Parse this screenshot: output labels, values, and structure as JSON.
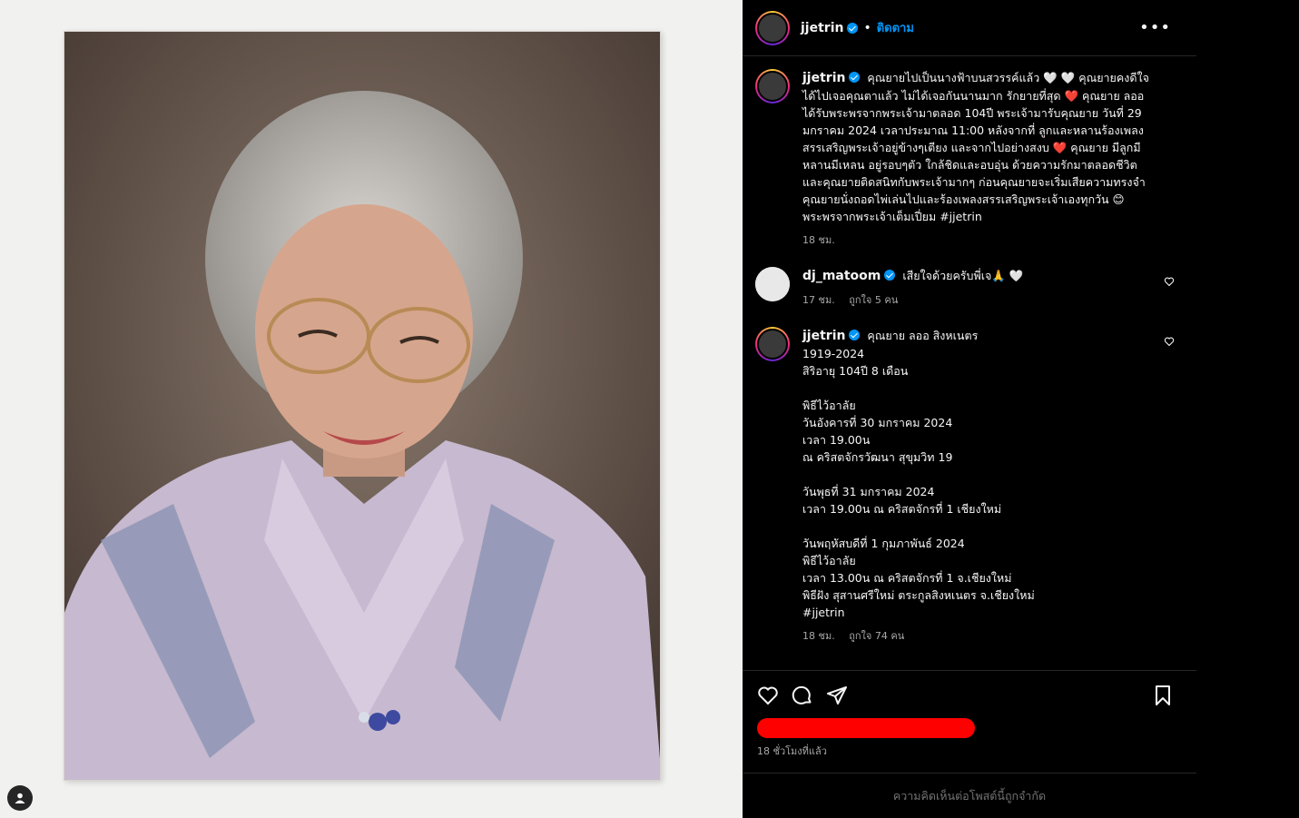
{
  "post": {
    "username": "jjetrin",
    "follow_label": "ติดตาม",
    "more_label": "•••"
  },
  "caption": {
    "username": "jjetrin",
    "text": "คุณยายไปเป็นนางฟ้าบนสวรรค์แล้ว 🤍 🤍 คุณยายคงดีใจ ได้ไปเจอคุณตาแล้ว ไม่ได้เจอกันนานมาก รักยายที่สุด ❤️ คุณยาย ลออ ได้รับพระพรจากพระเจ้ามาตลอด 104ปี พระเจ้ามารับคุณยาย วันที่ 29 มกราคม 2024 เวลาประมาณ 11:00 หลังจากที่ ลูกและหลานร้องเพลงสรรเสริญพระเจ้าอยู่ข้างๆเตียง และจากไปอย่างสงบ ❤️ คุณยาย มีลูกมีหลานมีเหลน อยู่รอบๆตัว ใกล้ชิดและอบอุ่น ด้วยความรักมาตลอดชีวิต และคุณยายติดสนิทกับพระเจ้ามากๆ ก่อนคุณยายจะเริ่มเสียความทรงจำ คุณยายนั่งถอดไพ่เล่นไปและร้องเพลงสรรเสริญพระเจ้าเองทุกวัน 😊 พระพรจากพระเจ้าเต็มเปี่ยม #jjetrin",
    "time": "18 ชม."
  },
  "comments": [
    {
      "username": "dj_matoom",
      "text": "เสียใจด้วยครับพี่เจ🙏 🤍",
      "time": "17 ชม.",
      "likes": "ถูกใจ 5 คน"
    },
    {
      "username": "jjetrin",
      "text": "คุณยาย ลออ สิงหเนตร\n1919-2024\nสิริอายุ 104ปี 8 เดือน\n\nพิธีไว้อาลัย\nวันอังคารที่ 30 มกราคม 2024\nเวลา 19.00น\nณ คริสตจักรวัฒนา สุขุมวิท 19\n\nวันพุธที่ 31 มกราคม 2024\nเวลา 19.00น ณ คริสตจักรที่ 1 เชียงใหม่\n\nวันพฤหัสบดีที่ 1 กุมภาพันธ์ 2024\nพิธีไว้อาลัย\nเวลา 13.00น ณ คริสตจักรที่ 1 จ.เชียงใหม่\nพิธีฝัง สุสานศรีใหม่ ตระกูลสิงหเนตร จ.เชียงใหม่\n#jjetrin",
      "time": "18 ชม.",
      "likes": "ถูกใจ 74 คน"
    }
  ],
  "footer": {
    "timestamp": "18 ชั่วโมงที่แล้ว",
    "restricted_notice": "ความคิดเห็นต่อโพสต์นี้ถูกจำกัด"
  },
  "colors": {
    "accent": "#0095f6",
    "redaction": "#ff0000",
    "background": "#000000"
  },
  "icons": [
    "heart-icon",
    "comment-icon",
    "share-icon",
    "bookmark-icon",
    "more-icon",
    "user-tag-icon"
  ]
}
